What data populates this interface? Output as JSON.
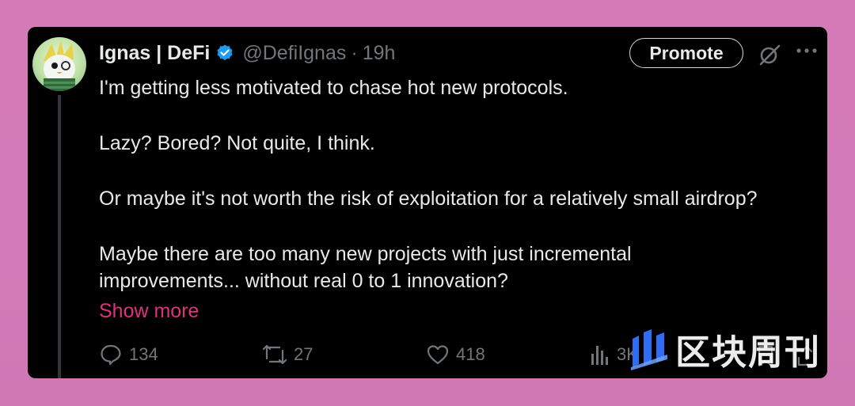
{
  "tweet": {
    "author_name": "Ignas | DeFi",
    "handle": "@DefiIgnas",
    "separator": "·",
    "time": "19h",
    "promote_label": "Promote",
    "paragraphs": [
      "I'm getting less motivated to chase hot new protocols.",
      "Lazy? Bored? Not quite, I think.",
      "Or maybe it's not worth the risk of exploitation for a relatively small airdrop?",
      "Maybe there are too many new projects with just incremental improvements... without real 0 to 1 innovation?"
    ],
    "show_more": "Show more",
    "actions": {
      "replies": "134",
      "reposts": "27",
      "likes": "418",
      "views": "3K"
    }
  },
  "icons": {
    "verified": "verified-badge-icon",
    "grok": "grok-icon",
    "more": "more-icon",
    "reply": "reply-icon",
    "repost": "repost-icon",
    "like": "heart-icon",
    "views": "views-icon"
  },
  "watermark": {
    "text": "区块周刊"
  },
  "colors": {
    "background": "#d57ab6",
    "card": "#000000",
    "text": "#e7e9ea",
    "muted": "#71767b",
    "accent_link": "#e0317e",
    "verified": "#1d9bf0",
    "watermark_blue": "#2f6df6"
  }
}
